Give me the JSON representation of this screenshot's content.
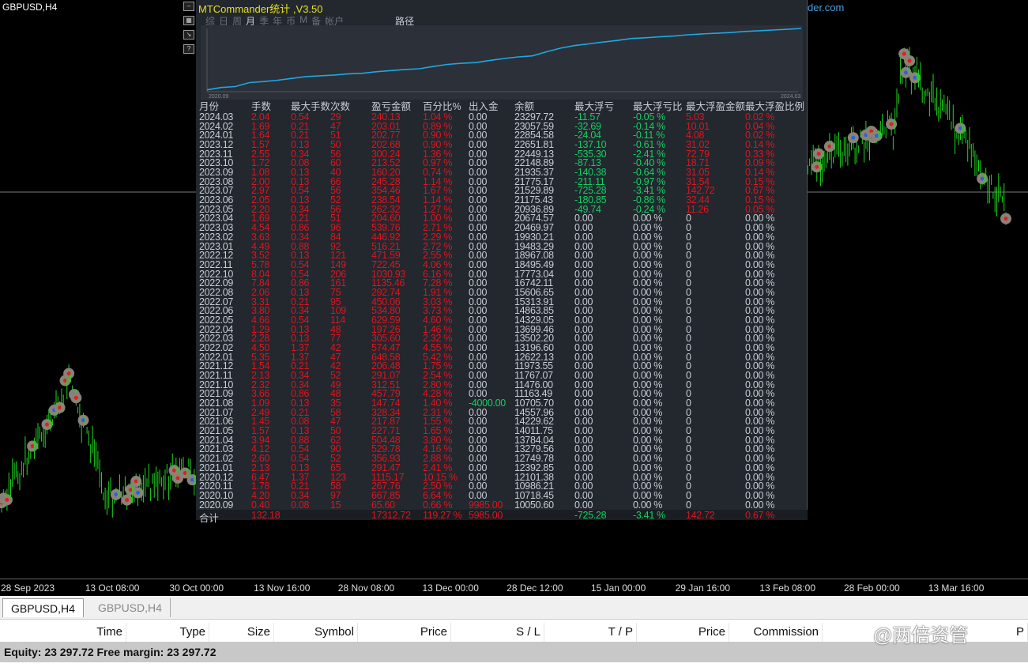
{
  "chart": {
    "symbol": "GBPUSD,H4",
    "url": "http://MTCommander.com",
    "side_icons": [
      "minimize-icon",
      "screenshot-icon",
      "chart-icon",
      "help-icon"
    ],
    "time_ticks": [
      "28 Sep 2023",
      "13 Oct 08:00",
      "30 Oct 00:00",
      "13 Nov 16:00",
      "28 Nov 08:00",
      "13 Dec 00:00",
      "28 Dec 12:00",
      "15 Jan 00:00",
      "29 Jan 16:00",
      "13 Feb 08:00",
      "28 Feb 00:00",
      "13 Mar 16:00"
    ]
  },
  "panel": {
    "title": "MTCommander统计 ,V3.50",
    "tabs": [
      "综",
      "日",
      "周",
      "月",
      "季",
      "年",
      "币",
      "M",
      "备",
      "帐户"
    ],
    "active_tab": "月",
    "path_button": "路径",
    "equity_start": "2020.09",
    "equity_end": "2024.03",
    "headers": [
      "月份",
      "手数",
      "最大手数",
      "次数",
      "盈亏金额",
      "百分比%",
      "出入金",
      "余额",
      "最大浮亏",
      "最大浮亏比",
      "最大浮盈金额",
      "最大浮盈比例"
    ],
    "rows": [
      [
        "2024.03",
        "2.04",
        "0.54",
        "29",
        "240.13",
        "1.04 %",
        "0.00",
        "23297.72",
        "-11.57",
        "-0.05 %",
        "5.03",
        "0.02 %"
      ],
      [
        "2024.02",
        "1.69",
        "0.21",
        "47",
        "203.01",
        "0.89 %",
        "0.00",
        "23057.59",
        "-32.69",
        "-0.14 %",
        "10.01",
        "0.04 %"
      ],
      [
        "2024.01",
        "1.64",
        "0.21",
        "51",
        "202.77",
        "0.90 %",
        "0.00",
        "22854.58",
        "-24.04",
        "-0.11 %",
        "4.08",
        "0.02 %"
      ],
      [
        "2023.12",
        "1.57",
        "0.13",
        "50",
        "202.68",
        "0.90 %",
        "0.00",
        "22651.81",
        "-137.10",
        "-0.61 %",
        "31.02",
        "0.14 %"
      ],
      [
        "2023.11",
        "2.55",
        "0.34",
        "56",
        "300.24",
        "1.36 %",
        "0.00",
        "22449.13",
        "-535.30",
        "-2.41 %",
        "72.79",
        "0.33 %"
      ],
      [
        "2023.10",
        "1.72",
        "0.08",
        "60",
        "213.52",
        "0.97 %",
        "0.00",
        "22148.89",
        "-87.13",
        "-0.40 %",
        "18.71",
        "0.09 %"
      ],
      [
        "2023.09",
        "1.08",
        "0.13",
        "40",
        "160.20",
        "0.74 %",
        "0.00",
        "21935.37",
        "-140.38",
        "-0.64 %",
        "31.05",
        "0.14 %"
      ],
      [
        "2023.08",
        "2.00",
        "0.13",
        "66",
        "245.28",
        "1.14 %",
        "0.00",
        "21775.17",
        "-211.11",
        "-0.97 %",
        "31.54",
        "0.15 %"
      ],
      [
        "2023.07",
        "2.97",
        "0.54",
        "56",
        "354.46",
        "1.67 %",
        "0.00",
        "21529.89",
        "-725.28",
        "-3.41 %",
        "142.72",
        "0.67 %"
      ],
      [
        "2023.06",
        "2.05",
        "0.13",
        "52",
        "238.54",
        "1.14 %",
        "0.00",
        "21175.43",
        "-180.85",
        "-0.86 %",
        "32.44",
        "0.15 %"
      ],
      [
        "2023.05",
        "2.20",
        "0.34",
        "56",
        "262.32",
        "1.27 %",
        "0.00",
        "20936.89",
        "-49.74",
        "-0.24 %",
        "11.26",
        "0.05 %"
      ],
      [
        "2023.04",
        "1.69",
        "0.21",
        "51",
        "204.60",
        "1.00 %",
        "0.00",
        "20674.57",
        "0.00",
        "0.00 %",
        "0",
        "0.00 %"
      ],
      [
        "2023.03",
        "4.54",
        "0.86",
        "96",
        "539.76",
        "2.71 %",
        "0.00",
        "20469.97",
        "0.00",
        "0.00 %",
        "0",
        "0.00 %"
      ],
      [
        "2023.02",
        "3.63",
        "0.34",
        "84",
        "446.92",
        "2.29 %",
        "0.00",
        "19930.21",
        "0.00",
        "0.00 %",
        "0",
        "0.00 %"
      ],
      [
        "2023.01",
        "4.49",
        "0.88",
        "92",
        "516.21",
        "2.72 %",
        "0.00",
        "19483.29",
        "0.00",
        "0.00 %",
        "0",
        "0.00 %"
      ],
      [
        "2022.12",
        "3.52",
        "0.13",
        "121",
        "471.59",
        "2.55 %",
        "0.00",
        "18967.08",
        "0.00",
        "0.00 %",
        "0",
        "0.00 %"
      ],
      [
        "2022.11",
        "5.78",
        "0.54",
        "149",
        "722.45",
        "4.06 %",
        "0.00",
        "18495.49",
        "0.00",
        "0.00 %",
        "0",
        "0.00 %"
      ],
      [
        "2022.10",
        "8.04",
        "0.54",
        "206",
        "1030.93",
        "6.16 %",
        "0.00",
        "17773.04",
        "0.00",
        "0.00 %",
        "0",
        "0.00 %"
      ],
      [
        "2022.09",
        "7.84",
        "0.86",
        "161",
        "1135.46",
        "7.28 %",
        "0.00",
        "16742.11",
        "0.00",
        "0.00 %",
        "0",
        "0.00 %"
      ],
      [
        "2022.08",
        "2.06",
        "0.13",
        "75",
        "292.74",
        "1.91 %",
        "0.00",
        "15606.65",
        "0.00",
        "0.00 %",
        "0",
        "0.00 %"
      ],
      [
        "2022.07",
        "3.31",
        "0.21",
        "95",
        "450.06",
        "3.03 %",
        "0.00",
        "15313.91",
        "0.00",
        "0.00 %",
        "0",
        "0.00 %"
      ],
      [
        "2022.06",
        "3.80",
        "0.34",
        "109",
        "534.80",
        "3.73 %",
        "0.00",
        "14863.85",
        "0.00",
        "0.00 %",
        "0",
        "0.00 %"
      ],
      [
        "2022.05",
        "4.66",
        "0.54",
        "114",
        "629.59",
        "4.60 %",
        "0.00",
        "14329.05",
        "0.00",
        "0.00 %",
        "0",
        "0.00 %"
      ],
      [
        "2022.04",
        "1.29",
        "0.13",
        "48",
        "197.26",
        "1.46 %",
        "0.00",
        "13699.46",
        "0.00",
        "0.00 %",
        "0",
        "0.00 %"
      ],
      [
        "2022.03",
        "2.28",
        "0.13",
        "77",
        "305.60",
        "2.32 %",
        "0.00",
        "13502.20",
        "0.00",
        "0.00 %",
        "0",
        "0.00 %"
      ],
      [
        "2022.02",
        "4.50",
        "1.37",
        "42",
        "574.47",
        "4.55 %",
        "0.00",
        "13196.60",
        "0.00",
        "0.00 %",
        "0",
        "0.00 %"
      ],
      [
        "2022.01",
        "5.35",
        "1.37",
        "47",
        "648.58",
        "5.42 %",
        "0.00",
        "12622.13",
        "0.00",
        "0.00 %",
        "0",
        "0.00 %"
      ],
      [
        "2021.12",
        "1.54",
        "0.21",
        "42",
        "206.48",
        "1.75 %",
        "0.00",
        "11973.55",
        "0.00",
        "0.00 %",
        "0",
        "0.00 %"
      ],
      [
        "2021.11",
        "2.13",
        "0.34",
        "52",
        "291.07",
        "2.54 %",
        "0.00",
        "11767.07",
        "0.00",
        "0.00 %",
        "0",
        "0.00 %"
      ],
      [
        "2021.10",
        "2.32",
        "0.34",
        "49",
        "312.51",
        "2.80 %",
        "0.00",
        "11476.00",
        "0.00",
        "0.00 %",
        "0",
        "0.00 %"
      ],
      [
        "2021.09",
        "3.66",
        "0.86",
        "48",
        "457.79",
        "4.28 %",
        "0.00",
        "11163.49",
        "0.00",
        "0.00 %",
        "0",
        "0.00 %"
      ],
      [
        "2021.08",
        "1.09",
        "0.13",
        "35",
        "147.74",
        "1.40 %",
        "-4000.00",
        "10705.70",
        "0.00",
        "0.00 %",
        "0",
        "0.00 %"
      ],
      [
        "2021.07",
        "2.49",
        "0.21",
        "58",
        "328.34",
        "2.31 %",
        "0.00",
        "14557.96",
        "0.00",
        "0.00 %",
        "0",
        "0.00 %"
      ],
      [
        "2021.06",
        "1.45",
        "0.08",
        "47",
        "217.87",
        "1.55 %",
        "0.00",
        "14229.62",
        "0.00",
        "0.00 %",
        "0",
        "0.00 %"
      ],
      [
        "2021.05",
        "1.57",
        "0.13",
        "50",
        "227.71",
        "1.65 %",
        "0.00",
        "14011.75",
        "0.00",
        "0.00 %",
        "0",
        "0.00 %"
      ],
      [
        "2021.04",
        "3.94",
        "0.88",
        "62",
        "504.48",
        "3.80 %",
        "0.00",
        "13784.04",
        "0.00",
        "0.00 %",
        "0",
        "0.00 %"
      ],
      [
        "2021.03",
        "4.12",
        "0.54",
        "90",
        "529.78",
        "4.16 %",
        "0.00",
        "13279.56",
        "0.00",
        "0.00 %",
        "0",
        "0.00 %"
      ],
      [
        "2021.02",
        "2.60",
        "0.54",
        "52",
        "356.93",
        "2.88 %",
        "0.00",
        "12749.78",
        "0.00",
        "0.00 %",
        "0",
        "0.00 %"
      ],
      [
        "2021.01",
        "2.13",
        "0.13",
        "65",
        "291.47",
        "2.41 %",
        "0.00",
        "12392.85",
        "0.00",
        "0.00 %",
        "0",
        "0.00 %"
      ],
      [
        "2020.12",
        "6.47",
        "1.37",
        "123",
        "1115.17",
        "10.15 %",
        "0.00",
        "12101.38",
        "0.00",
        "0.00 %",
        "0",
        "0.00 %"
      ],
      [
        "2020.11",
        "1.78",
        "0.21",
        "58",
        "267.76",
        "2.50 %",
        "0.00",
        "10986.21",
        "0.00",
        "0.00 %",
        "0",
        "0.00 %"
      ],
      [
        "2020.10",
        "4.20",
        "0.34",
        "97",
        "667.85",
        "6.64 %",
        "0.00",
        "10718.45",
        "0.00",
        "0.00 %",
        "0",
        "0.00 %"
      ],
      [
        "2020.09",
        "0.40",
        "0.08",
        "15",
        "65.60",
        "0.66 %",
        "9985.00",
        "10050.60",
        "0.00",
        "0.00 %",
        "0",
        "0.00 %"
      ]
    ],
    "total": [
      "合计",
      "132.18",
      "",
      "",
      "17312.72",
      "119.27 %",
      "5985.00",
      "",
      "-725.28",
      "-3.41 %",
      "142.72",
      "0.67 %"
    ]
  },
  "tabs": [
    "GBPUSD,H4",
    "GBPUSD,H4"
  ],
  "trade_columns": [
    "Time",
    "Type",
    "Size",
    "Symbol",
    "Price",
    "S / L",
    "T / P",
    "Price",
    "Commission",
    "",
    "P"
  ],
  "status": "Equity: 23 297.72  Free margin: 23 297.72",
  "watermark": "@两倍资管",
  "colors": {
    "red": "#e0141e",
    "green": "#12d060",
    "gray": "#c8ccd4",
    "curve": "#1fa8e0"
  }
}
